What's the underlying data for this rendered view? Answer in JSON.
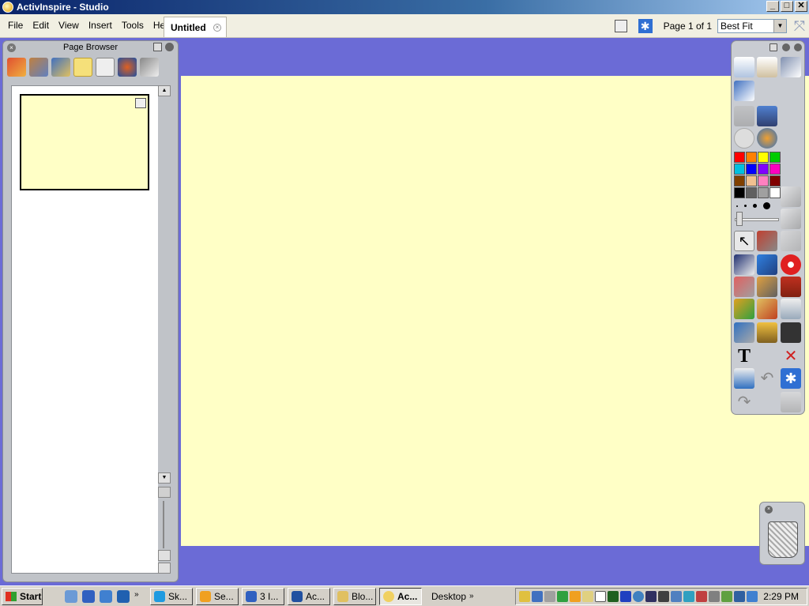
{
  "window": {
    "title": "ActivInspire - Studio",
    "min": "_",
    "max": "□",
    "close": "✕"
  },
  "menubar": {
    "items": [
      "File",
      "Edit",
      "View",
      "Insert",
      "Tools",
      "Help"
    ],
    "document_tab": "Untitled",
    "page_label": "Page 1 of 1",
    "zoom_value": "Best Fit"
  },
  "page_browser": {
    "title": "Page Browser"
  },
  "palette": {
    "colors": [
      "#ff0000",
      "#ff8000",
      "#ffff00",
      "#00cc00",
      "#00c0e0",
      "#0000ff",
      "#8000ff",
      "#ff00c0",
      "#804000",
      "#f0c090",
      "#ff80c0",
      "#800000",
      "#000000",
      "#606060",
      "#a0a0a0",
      "#ffffff"
    ]
  },
  "taskbar": {
    "start": "Start",
    "tasks": [
      "Sk...",
      "Se...",
      "3 I...",
      "Ac...",
      "Blo...",
      "Ac..."
    ],
    "desktop": "Desktop",
    "clock": "2:29 PM"
  }
}
